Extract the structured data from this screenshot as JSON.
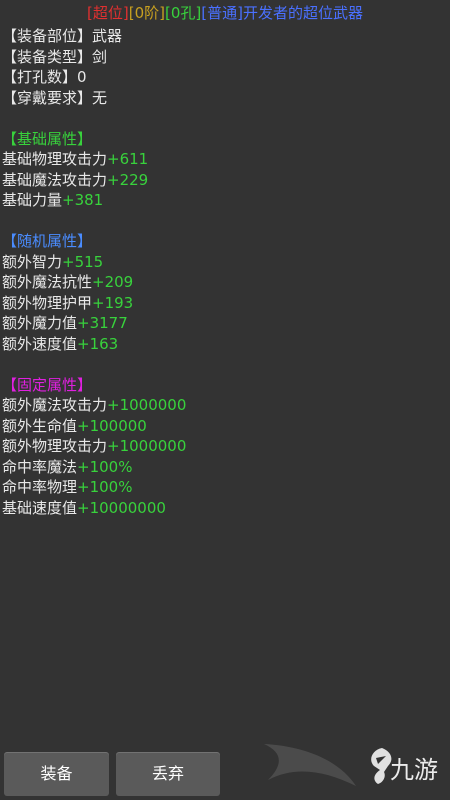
{
  "header": {
    "segments": [
      {
        "text": "[超位]",
        "color": "#e03030"
      },
      {
        "text": "[0阶]",
        "color": "#c8a020"
      },
      {
        "text": "[0孔]",
        "color": "#38d23c"
      },
      {
        "text": "[普通]",
        "color": "#4a70ff"
      },
      {
        "text": "开发者的超位武器",
        "color": "#4a70ff"
      }
    ]
  },
  "basic_info": [
    {
      "label": "【装备部位】",
      "value": "武器"
    },
    {
      "label": "【装备类型】",
      "value": "剑"
    },
    {
      "label": "【打孔数】",
      "value": "0"
    },
    {
      "label": "【穿戴要求】",
      "value": "无"
    }
  ],
  "sections": [
    {
      "title": "【基础属性】",
      "color": "#38d23c",
      "items": [
        {
          "name": "基础物理攻击力",
          "value": "+611"
        },
        {
          "name": "基础魔法攻击力",
          "value": "+229"
        },
        {
          "name": "基础力量",
          "value": "+381"
        }
      ]
    },
    {
      "title": "【随机属性】",
      "color": "#4a8cff",
      "items": [
        {
          "name": "额外智力",
          "value": "+515"
        },
        {
          "name": "额外魔法抗性",
          "value": "+209"
        },
        {
          "name": "额外物理护甲",
          "value": "+193"
        },
        {
          "name": "额外魔力值",
          "value": "+3177"
        },
        {
          "name": "额外速度值",
          "value": "+163"
        }
      ]
    },
    {
      "title": "【固定属性】",
      "color": "#e020e0",
      "items": [
        {
          "name": "额外魔法攻击力",
          "value": "+1000000"
        },
        {
          "name": "额外生命值",
          "value": "+100000"
        },
        {
          "name": "额外物理攻击力",
          "value": "+1000000"
        },
        {
          "name": "命中率魔法",
          "value": "+100%"
        },
        {
          "name": "命中率物理",
          "value": "+100%"
        },
        {
          "name": "基础速度值",
          "value": "+10000000"
        }
      ]
    }
  ],
  "buttons": {
    "equip": "装备",
    "drop": "丢弃"
  },
  "watermark": {
    "text": "九游",
    "icon": "jiuyou-logo-icon"
  }
}
